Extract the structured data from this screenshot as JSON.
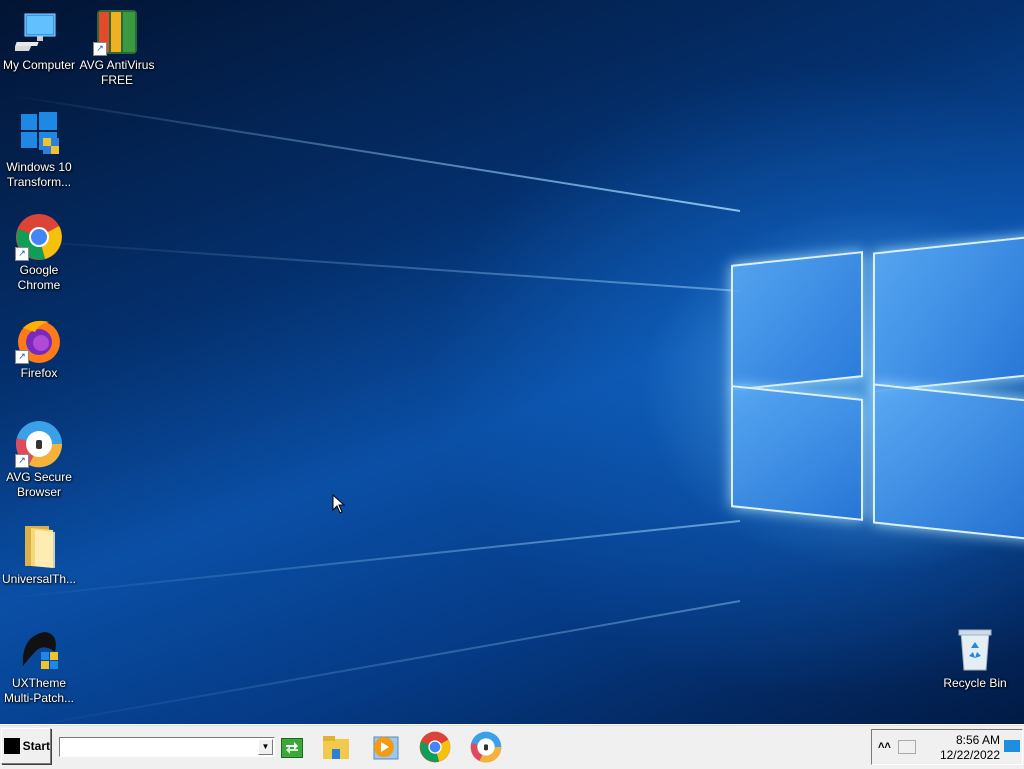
{
  "desktop": {
    "icons": [
      {
        "label": "My Computer",
        "icon": "computer-icon",
        "shortcut": false
      },
      {
        "label": "AVG AntiVirus FREE",
        "icon": "avg-antivirus-icon",
        "shortcut": true
      },
      {
        "label": "Windows 10 Transform...",
        "icon": "windows-logo-icon",
        "shortcut": false
      },
      {
        "label": "Google Chrome",
        "icon": "chrome-icon",
        "shortcut": true
      },
      {
        "label": "Firefox",
        "icon": "firefox-icon",
        "shortcut": true
      },
      {
        "label": "AVG Secure Browser",
        "icon": "avg-secure-browser-icon",
        "shortcut": true
      },
      {
        "label": "UniversalTh...",
        "icon": "folder-icon",
        "shortcut": false
      },
      {
        "label": "UXTheme Multi-Patch...",
        "icon": "uxtheme-icon",
        "shortcut": false
      },
      {
        "label": "Recycle Bin",
        "icon": "recycle-bin-icon",
        "shortcut": false
      }
    ]
  },
  "taskbar": {
    "start_label": "Start",
    "address_value": "",
    "pinned": [
      "file-explorer-icon",
      "media-player-icon",
      "chrome-icon",
      "avg-secure-browser-icon"
    ],
    "tray": {
      "time": "8:56 AM",
      "date": "12/22/2022"
    }
  },
  "colors": {
    "taskbar_bg": "#f0f0f0",
    "desktop_accent": "#0a4fa6"
  }
}
